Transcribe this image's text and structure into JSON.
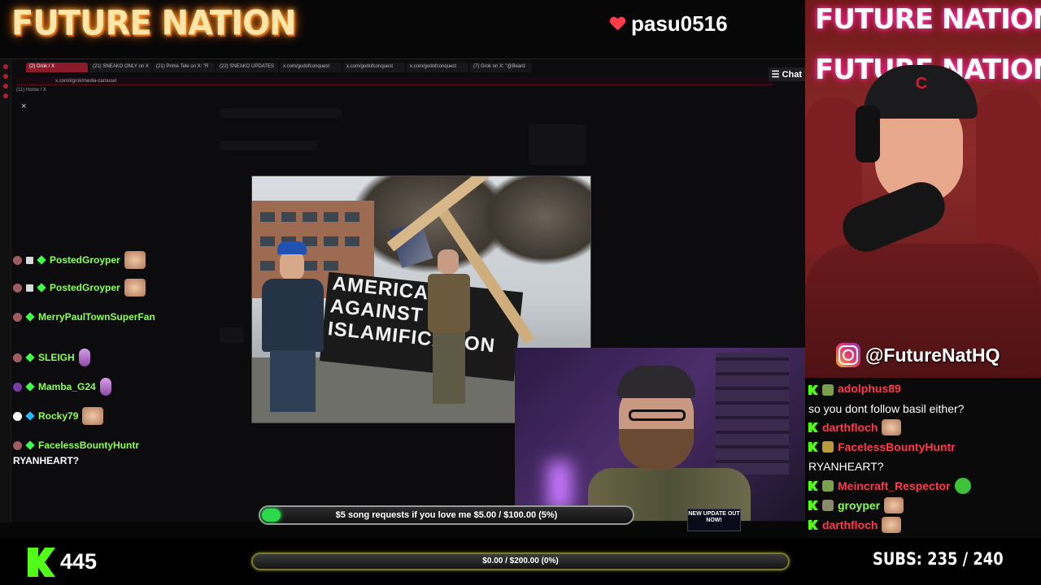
{
  "header": {
    "logo_text": "FUTURE NATION",
    "username": "pasu0516"
  },
  "browser": {
    "tabs": [
      "(2) Grok / X",
      "(21) SNEAKO ONLY on X",
      "(21) Prime Tele on X: \"R",
      "(22) SNEAKO UPDATES",
      "x.com/godofconquest",
      "x.com/godofconquest",
      "x.com/godofconquest",
      "(7) Grok on X: \"@Beard"
    ],
    "address": "x.com/i/grok/media-carousel",
    "bookmark": "(11) Home / X",
    "chat_button": "Chat",
    "close_icon": "×"
  },
  "photo": {
    "banner_lines": [
      "AMERICANS",
      "AGAINST",
      "ISLAMIFICATION"
    ]
  },
  "left_chat": [
    {
      "user": "PostedGroyper",
      "message": ""
    },
    {
      "user": "PostedGroyper",
      "message": ""
    },
    {
      "user": "MerryPaulTownSuperFan",
      "message": ""
    },
    {
      "user": "SLEIGH",
      "message": ""
    },
    {
      "user": "Mamba_G24",
      "message": ""
    },
    {
      "user": "Rocky79",
      "message": ""
    },
    {
      "user": "FacelessBountyHuntr",
      "message": "RYANHEART?"
    }
  ],
  "update_badge": "NEW UPDATE OUT NOW!",
  "song_request": {
    "label": "$5 song requests if you love me $5.00 / $100.00 (5%)",
    "progress": 0.05
  },
  "goal": {
    "label": "$0.00 / $200.00 (0%)",
    "progress": 0
  },
  "viewers": "445",
  "subs": "SUBS:  235 / 240",
  "streamer_cam": {
    "neon_text": "FUTURE NATION",
    "hat_logo": "C"
  },
  "instagram": "@FutureNatHQ",
  "right_chat": [
    {
      "user": "adolphus89",
      "message": "so you dont follow basil either?"
    },
    {
      "user": "darthfloch",
      "message": ""
    },
    {
      "user": "FacelessBountyHuntr",
      "message": "RYANHEART?"
    },
    {
      "user": "Meincraft_Respector",
      "message": ""
    },
    {
      "user": "groyper",
      "message": ""
    },
    {
      "user": "darthfloch",
      "message": ""
    }
  ],
  "colors": {
    "kick_green": "#53fc18",
    "chat_name_red": "#ff3a4d",
    "left_chat_green": "#8dff52"
  }
}
